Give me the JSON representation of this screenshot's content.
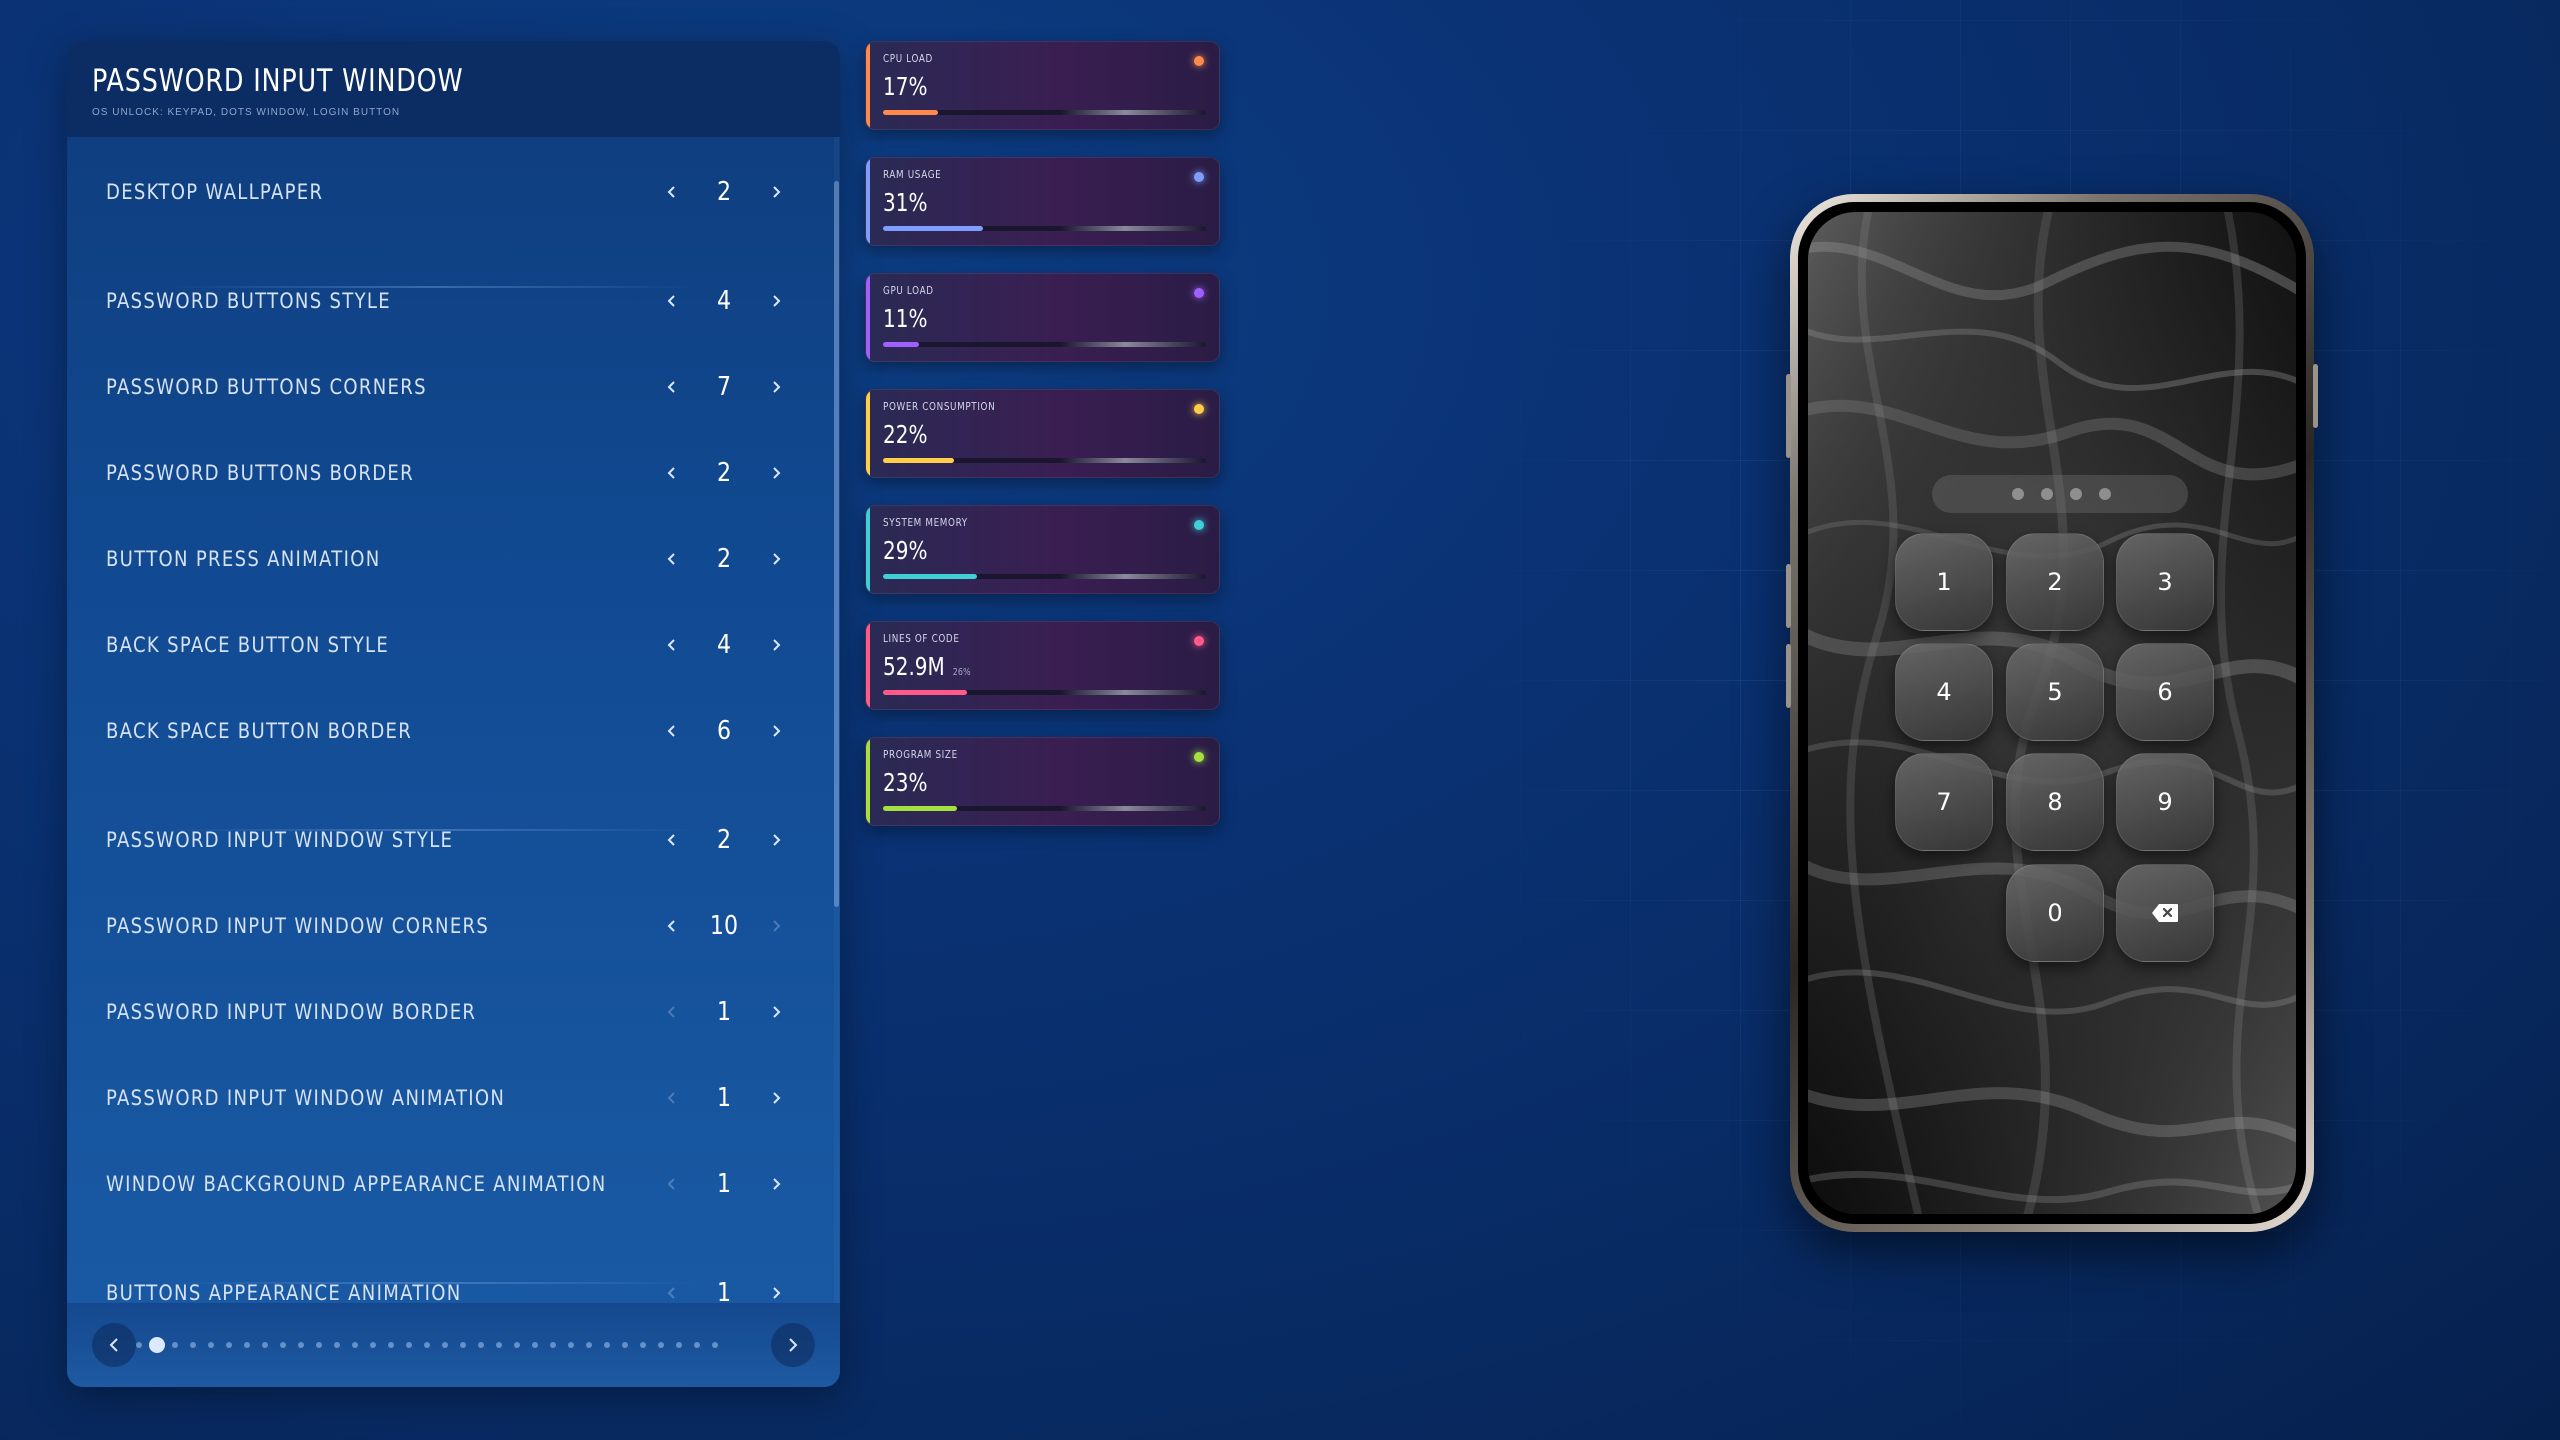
{
  "panel": {
    "title": "PASSWORD INPUT WINDOW",
    "subtitle": "OS UNLOCK: KEYPAD, DOTS WINDOW, LOGIN BUTTON",
    "rows": [
      {
        "label": "DESKTOP WALLPAPER",
        "value": "2",
        "left_enabled": true,
        "right_enabled": true
      },
      {
        "label": "PASSWORD BUTTONS STYLE",
        "value": "4",
        "left_enabled": true,
        "right_enabled": true
      },
      {
        "label": "PASSWORD BUTTONS CORNERS",
        "value": "7",
        "left_enabled": true,
        "right_enabled": true
      },
      {
        "label": "PASSWORD BUTTONS BORDER",
        "value": "2",
        "left_enabled": true,
        "right_enabled": true
      },
      {
        "label": "BUTTON PRESS ANIMATION",
        "value": "2",
        "left_enabled": true,
        "right_enabled": true
      },
      {
        "label": "BACK SPACE BUTTON STYLE",
        "value": "4",
        "left_enabled": true,
        "right_enabled": true
      },
      {
        "label": "BACK SPACE BUTTON BORDER",
        "value": "6",
        "left_enabled": true,
        "right_enabled": true
      },
      {
        "label": "PASSWORD INPUT WINDOW STYLE",
        "value": "2",
        "left_enabled": true,
        "right_enabled": true
      },
      {
        "label": "PASSWORD INPUT WINDOW CORNERS",
        "value": "10",
        "left_enabled": true,
        "right_enabled": false
      },
      {
        "label": "PASSWORD INPUT WINDOW BORDER",
        "value": "1",
        "left_enabled": false,
        "right_enabled": true
      },
      {
        "label": "PASSWORD INPUT WINDOW ANIMATION",
        "value": "1",
        "left_enabled": false,
        "right_enabled": true
      },
      {
        "label": "WINDOW BACKGROUND APPEARANCE ANIMATION",
        "value": "1",
        "left_enabled": false,
        "right_enabled": true
      },
      {
        "label": "BUTTONS APPEARANCE ANIMATION",
        "value": "1",
        "left_enabled": false,
        "right_enabled": true
      }
    ],
    "pager": {
      "page_count": 33,
      "current_page": 2
    }
  },
  "stats": [
    {
      "label": "CPU LOAD",
      "value": "17%",
      "extra": "",
      "percent": 17,
      "color": "#ff8a4c"
    },
    {
      "label": "RAM USAGE",
      "value": "31%",
      "extra": "",
      "percent": 31,
      "color": "#7f9cff"
    },
    {
      "label": "GPU LOAD",
      "value": "11%",
      "extra": "",
      "percent": 11,
      "color": "#a060ff"
    },
    {
      "label": "POWER CONSUMPTION",
      "value": "22%",
      "extra": "",
      "percent": 22,
      "color": "#ffce4a"
    },
    {
      "label": "SYSTEM MEMORY",
      "value": "29%",
      "extra": "",
      "percent": 29,
      "color": "#3ed0d6"
    },
    {
      "label": "LINES OF CODE",
      "value": "52.9M",
      "extra": "26%",
      "percent": 26,
      "color": "#ff5a8a"
    },
    {
      "label": "PROGRAM SIZE",
      "value": "23%",
      "extra": "",
      "percent": 23,
      "color": "#a6e040"
    }
  ],
  "phone": {
    "keys": [
      "1",
      "2",
      "3",
      "4",
      "5",
      "6",
      "7",
      "8",
      "9",
      "0"
    ],
    "backspace_icon": "backspace-icon",
    "password_dots": 4
  }
}
